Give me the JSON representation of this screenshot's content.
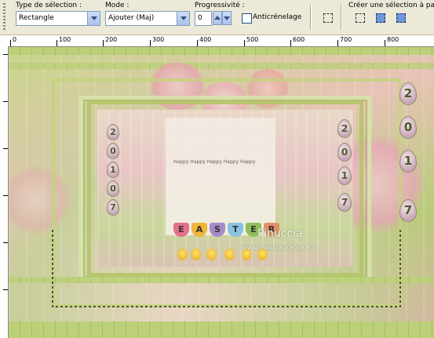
{
  "toolbar": {
    "selection_type_label": "Type de sélection :",
    "selection_type_value": "Rectangle",
    "mode_label": "Mode :",
    "mode_value": "Ajouter (Maj)",
    "feather_label": "Progressivité :",
    "feather_value": "0",
    "antialias_label": "Anticrénelage",
    "antialias_checked": false,
    "create_from_label": "Créer une sélection à parti"
  },
  "ruler": {
    "top_marks": [
      "0",
      "100",
      "200",
      "300",
      "400",
      "500",
      "600",
      "700",
      "800"
    ],
    "left_marks": [
      "0",
      "100",
      "200",
      "300",
      "400",
      "500"
    ]
  },
  "artwork": {
    "header_text": "Happy Happy Happy Happy Happy",
    "tulip_letters": [
      "E",
      "A",
      "S",
      "T",
      "E",
      "R"
    ],
    "egg_digits_left": [
      "2",
      "0",
      "1",
      "0",
      "7"
    ],
    "egg_digits_right": [
      "2",
      "0",
      "1",
      "7"
    ],
    "egg_digits_far_right": [
      "2",
      "0",
      "1",
      "7"
    ],
    "signature": "Pinuccia",
    "website": "www.maidiragrafica.eu"
  },
  "colors": {
    "toolbar_bg": "#ece9d8",
    "accent_green": "#a6bd5c",
    "accent_pink": "#e7c3b7"
  }
}
